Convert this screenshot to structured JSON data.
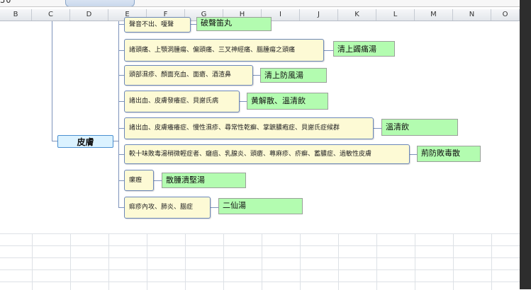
{
  "formula_bar": {
    "cell_ref": "30"
  },
  "columns": [
    "B",
    "C",
    "D",
    "E",
    "F",
    "G",
    "H",
    "I",
    "J",
    "K",
    "L",
    "M",
    "N",
    "O"
  ],
  "root": {
    "label": "皮膚"
  },
  "branches": [
    {
      "condition": "聲音不出、嗄聲",
      "remedy": "破聲笛丸"
    },
    {
      "condition": "諸頭痛、上顎洞腫瘍、偏頭痛、三叉神經痛、腦腫瘍之頭痛",
      "remedy": "清上蠲痛湯"
    },
    {
      "condition": "頭部濕疹、顏面充血、面瘡、酒渣鼻",
      "remedy": "清上防風湯"
    },
    {
      "condition": "諸出血、皮膚發癢症、貝謝氏病",
      "remedy": "黄解散、溫清飲"
    },
    {
      "condition": "諸出血、皮膚癢癢症、慢性濕疹、尋常性乾癬、掌蹠膿疱症、貝謝氏症候群",
      "remedy": "溫清飲"
    },
    {
      "condition": "較十味敗毒湯稍微輕症者、癰疽、乳腺炎、頭瘡、蕁麻疹、疥癬、蓄膿症、過敏性皮膚",
      "remedy": "荊防敗毒散"
    },
    {
      "condition": "瘰癧",
      "remedy": "散腫潰堅湯"
    },
    {
      "condition": "痲疹內攻、肺炎、腦症",
      "remedy": "二仙湯"
    }
  ]
}
